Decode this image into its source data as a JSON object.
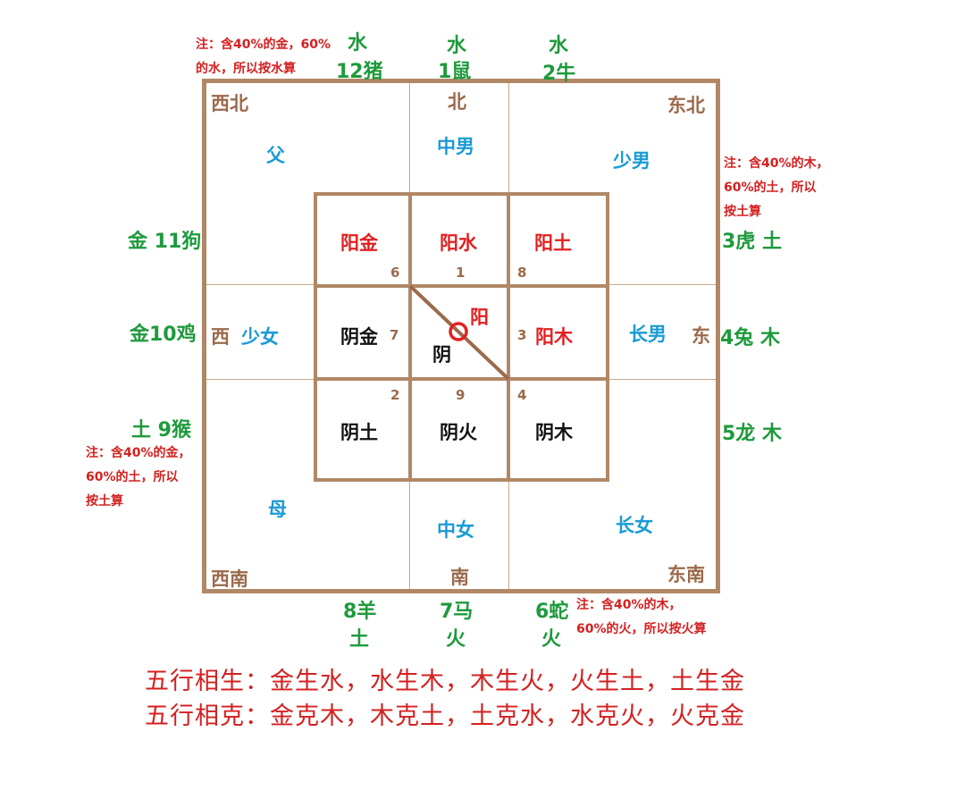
{
  "notes": {
    "top_left": [
      "注：含40%的金，60%",
      "的水，所以按水算"
    ],
    "right": [
      "注：含40%的木，",
      "60%的土，所以",
      "按土算"
    ],
    "left": [
      "注：含40%的金，",
      "60%的土，所以",
      "按土算"
    ],
    "bottom": [
      "注：含40%的木，",
      "60%的火，所以按火算"
    ]
  },
  "zodiac": {
    "pig": [
      "水",
      "12猪"
    ],
    "rat": [
      "水",
      "1鼠"
    ],
    "ox": [
      "水",
      "2牛"
    ],
    "dog": "金 11狗",
    "rooster": "金10鸡",
    "monkey": "土  9猴",
    "tiger": "3虎 土",
    "rabbit": "4兔 木",
    "dragon": "5龙 木",
    "goat": [
      "8羊",
      "土"
    ],
    "horse": [
      "7马",
      "火"
    ],
    "snake": [
      "6蛇",
      "火"
    ]
  },
  "directions": {
    "northwest": "西北",
    "north": "北",
    "northeast": "东北",
    "west": "西",
    "east": "东",
    "southwest": "西南",
    "south": "南",
    "southeast": "东南"
  },
  "family": {
    "father": "父",
    "middle_son": "中男",
    "youngest_son": "少男",
    "youngest_daughter": "少女",
    "eldest_son": "长男",
    "mother": "母",
    "middle_daughter": "中女",
    "eldest_daughter": "长女"
  },
  "inner": {
    "yang_metal": "阳金",
    "yang_water": "阳水",
    "yang_earth": "阳土",
    "yin_metal": "阴金",
    "yang": "阳",
    "yin": "阴",
    "yang_wood": "阳木",
    "yin_earth": "阴土",
    "yin_fire": "阴火",
    "yin_wood": "阴木"
  },
  "numbers": {
    "n6": "6",
    "n1": "1",
    "n8": "8",
    "n7": "7",
    "n3": "3",
    "n2": "2",
    "n9": "9",
    "n4": "4"
  },
  "rules": {
    "sheng": "五行相生：金生水，水生木，木生火，火生土，土生金",
    "ke": "五行相克：金克木，木克土，土克水，水克火，火克金"
  },
  "colors": {
    "frame": "#b08866",
    "zodiac": "#1e9a3c",
    "family": "#1a9ad6",
    "yang": "#e02020",
    "yin": "#111111",
    "direction": "#9b6a4b",
    "note": "#d42020"
  }
}
